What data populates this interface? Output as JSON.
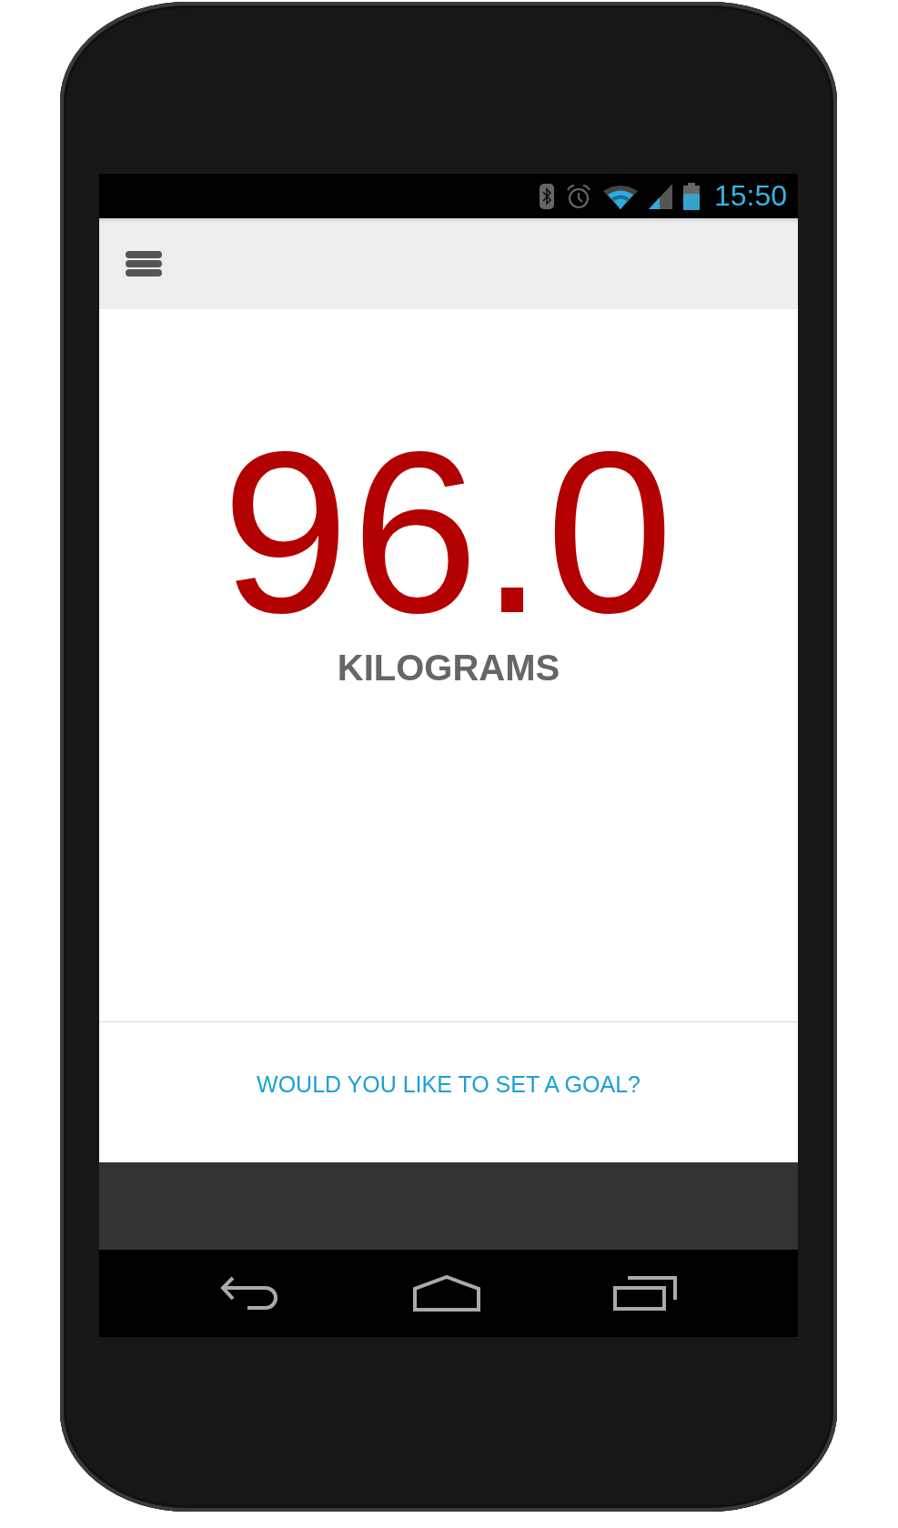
{
  "status_bar": {
    "time": "15:50"
  },
  "weight": {
    "value": "96.0",
    "unit": "KILOGRAMS"
  },
  "goal_prompt": "WOULD YOU LIKE TO SET A GOAL?"
}
